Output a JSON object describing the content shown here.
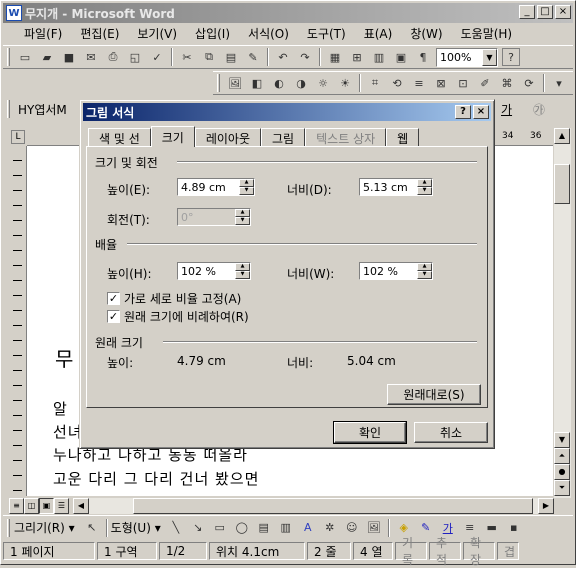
{
  "app": {
    "title": "무지개 - Microsoft Word",
    "icon": "W"
  },
  "window_buttons": [
    "_",
    "□",
    "×"
  ],
  "menu": [
    "파일(F)",
    "편집(E)",
    "보기(V)",
    "삽입(I)",
    "서식(O)",
    "도구(T)",
    "표(A)",
    "창(W)",
    "도움말(H)"
  ],
  "toolbar": {
    "zoom": "100%",
    "help_icon": "?"
  },
  "formatting": {
    "style": "HY엽서M",
    "font_color_label": "가"
  },
  "ruler": {
    "labels": [
      "34",
      "36"
    ]
  },
  "document": {
    "lines": [
      "무",
      "알",
      "선녀",
      "누나하고 나하고 동동 떠올라",
      "고운 다리 그 다리 건너 봤으면"
    ]
  },
  "drawbar": {
    "draw_label": "그리기(R)",
    "shapes_label": "도형(U)",
    "text_label": "가"
  },
  "status": {
    "page": "1 페이지",
    "section": "1 구역",
    "pages": "1/2",
    "position": "위치 4.1cm",
    "line": "2 줄",
    "column": "4 열",
    "rec": "기록",
    "trk": "추적",
    "ext": "확장",
    "ovr": "겹"
  },
  "dialog": {
    "title": "그림 서식",
    "tabs": [
      "색 및 선",
      "크기",
      "레이아웃",
      "그림",
      "텍스트 상자",
      "웹"
    ],
    "active_tab": "크기",
    "size_rotate": {
      "heading": "크기 및 회전",
      "height_label": "높이(E):",
      "height_value": "4.89 cm",
      "width_label": "너비(D):",
      "width_value": "5.13 cm",
      "rotation_label": "회전(T):",
      "rotation_value": "0°"
    },
    "scale": {
      "heading": "배율",
      "height_label": "높이(H):",
      "height_value": "102 %",
      "width_label": "너비(W):",
      "width_value": "102 %",
      "lock_aspect": "가로 세로 비율 고정(A)",
      "relative_original": "원래 크기에 비례하여(R)"
    },
    "original": {
      "heading": "원래 크기",
      "height_label": "높이:",
      "height_value": "4.79 cm",
      "width_label": "너비:",
      "width_value": "5.04 cm",
      "reset_button": "원래대로(S)"
    },
    "ok": "확인",
    "cancel": "취소"
  }
}
